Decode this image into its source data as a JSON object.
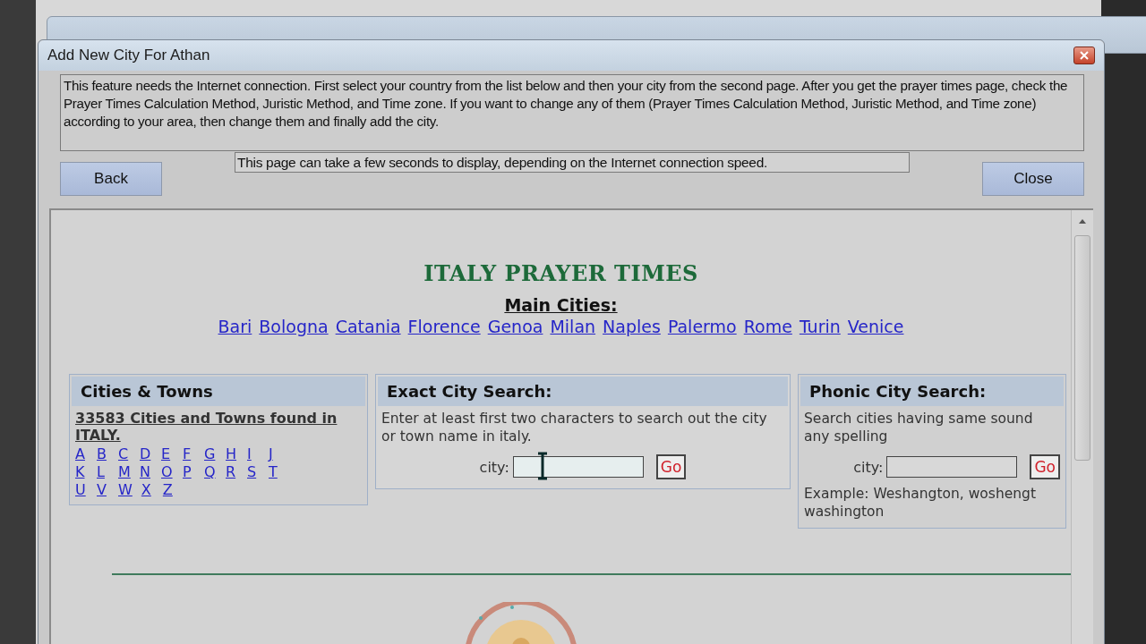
{
  "dialog": {
    "title": "Add New City For Athan",
    "description": "This feature needs the Internet connection. First select your country from the list below and then your city from the second page. After you get the prayer times page, check the Prayer Times Calculation Method, Juristic Method, and Time zone. If you want to change any of them (Prayer Times Calculation Method, Juristic Method, and Time zone) according to your area, then change them and finally add the city.",
    "note": "This page can take a few seconds to display, depending on the Internet connection speed.",
    "back_button": "Back",
    "close_button": "Close"
  },
  "page": {
    "heading": "ITALY PRAYER TIMES",
    "main_cities_label": "Main Cities:",
    "main_cities": [
      "Bari",
      "Bologna",
      "Catania",
      "Florence",
      "Genoa",
      "Milan",
      "Naples",
      "Palermo",
      "Rome",
      "Turin",
      "Venice"
    ],
    "cities_towns": {
      "title": "Cities & Towns",
      "count_link": "33583 Cities and Towns found in ITALY.",
      "letters": [
        [
          "A",
          "B",
          "C",
          "D",
          "E",
          "F",
          "G",
          "H",
          "I",
          "J"
        ],
        [
          "K",
          "L",
          "M",
          "N",
          "O",
          "P",
          "Q",
          "R",
          "S",
          "T"
        ],
        [
          "U",
          "V",
          "W",
          "X",
          "Z"
        ]
      ]
    },
    "exact_search": {
      "title": "Exact City Search:",
      "text": "Enter at least first two characters to search out the city or town name in italy.",
      "city_label": "city:",
      "go_button": "Go"
    },
    "phonic_search": {
      "title": "Phonic City Search:",
      "text": "Search cities having same sound any spelling",
      "city_label": "city:",
      "go_button": "Go",
      "example": "Example: Weshangton, woshengt washington"
    }
  }
}
